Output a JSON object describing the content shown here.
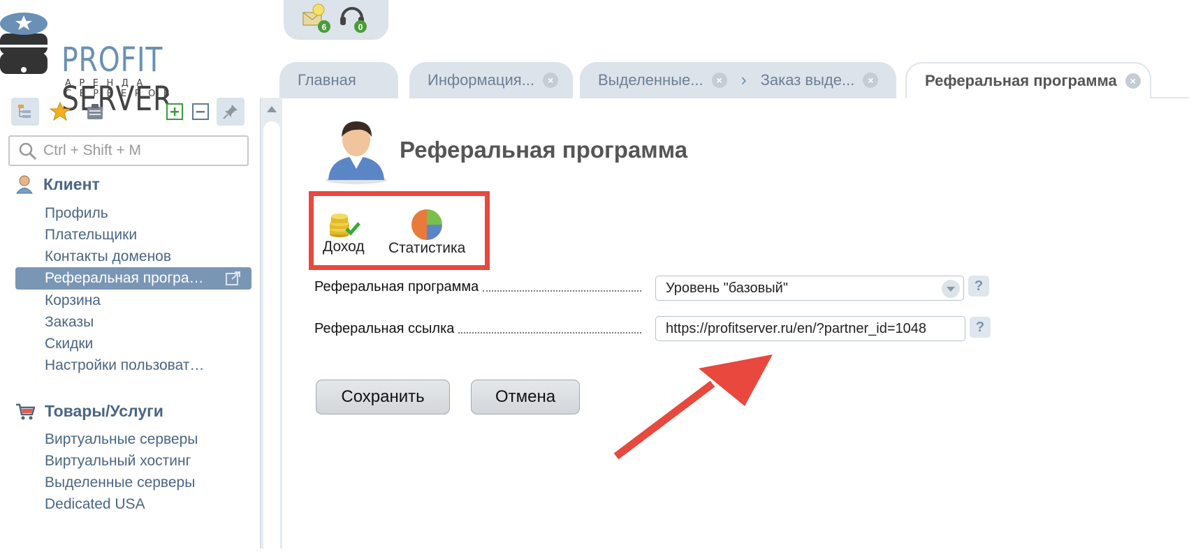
{
  "brand": {
    "name_part1": "PROFIT",
    "name_part2": " SERVER",
    "tagline": "АРЕНДА СЕРВЕРОВ"
  },
  "top_icons": [
    {
      "icon": "mail-notification-icon",
      "badge": "6"
    },
    {
      "icon": "support-headset-icon",
      "badge": "0"
    }
  ],
  "tabs": [
    {
      "label": "Главная",
      "closable": false
    },
    {
      "label": "Информация...",
      "closable": true
    },
    {
      "label": "Выделенные...",
      "closable": true
    },
    {
      "label": "Заказ выде...",
      "closable": true
    },
    {
      "label": "Реферальная программа",
      "closable": true,
      "active": true
    }
  ],
  "sidebar": {
    "search_placeholder": "Ctrl + Shift + M",
    "groups": [
      {
        "title": "Клиент",
        "items": [
          "Профиль",
          "Плательщики",
          "Контакты доменов",
          "Реферальная програ…",
          "Корзина",
          "Заказы",
          "Скидки",
          "Настройки пользоват…"
        ],
        "selected": 3
      },
      {
        "title": "Товары/Услуги",
        "items": [
          "Виртуальные серверы",
          "Виртуальный хостинг",
          "Выделенные серверы",
          "Dedicated USA"
        ]
      }
    ]
  },
  "main": {
    "title": "Реферальная программа",
    "toolbar": [
      {
        "label": "Доход",
        "icon": "coins-icon"
      },
      {
        "label": "Статистика",
        "icon": "pie-chart-icon"
      }
    ],
    "form": {
      "program_label": "Реферальная программа",
      "program_value": "Уровень \"базовый\"",
      "link_label": "Реферальная ссылка",
      "link_value": "https://profitserver.ru/en/?partner_id=1048",
      "help": "?"
    },
    "save_label": "Сохранить",
    "cancel_label": "Отмена"
  },
  "colors": {
    "accent": "#4a6684",
    "highlight_red": "#e8483d",
    "selected_item": "#7a96b5"
  }
}
